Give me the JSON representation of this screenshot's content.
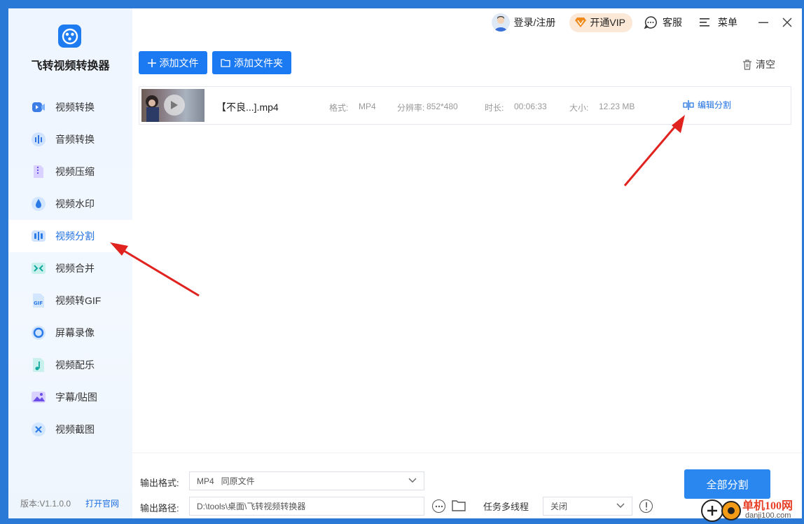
{
  "app": {
    "title": "飞转视频转换器",
    "version": "版本:V1.1.0.0",
    "site_link": "打开官网"
  },
  "topbar": {
    "login": "登录/注册",
    "vip": "开通VIP",
    "service": "客服",
    "menu": "菜单"
  },
  "sidebar": {
    "items": [
      {
        "label": "视频转换",
        "icon": "video-convert-icon"
      },
      {
        "label": "音频转换",
        "icon": "audio-convert-icon"
      },
      {
        "label": "视频压缩",
        "icon": "video-compress-icon"
      },
      {
        "label": "视频水印",
        "icon": "watermark-icon"
      },
      {
        "label": "视频分割",
        "icon": "video-split-icon"
      },
      {
        "label": "视频合并",
        "icon": "video-merge-icon"
      },
      {
        "label": "视频转GIF",
        "icon": "gif-icon"
      },
      {
        "label": "屏幕录像",
        "icon": "screen-record-icon"
      },
      {
        "label": "视频配乐",
        "icon": "music-icon"
      },
      {
        "label": "字幕/贴图",
        "icon": "subtitle-image-icon"
      },
      {
        "label": "视频截图",
        "icon": "screenshot-icon"
      }
    ],
    "active_index": 4
  },
  "toolbar": {
    "add_file": "添加文件",
    "add_folder": "添加文件夹",
    "clear": "清空"
  },
  "files": [
    {
      "name": "【不良...].mp4",
      "format_label": "格式:",
      "format": "MP4",
      "resolution_label": "分辨率:",
      "resolution": "852*480",
      "duration_label": "时长:",
      "duration": "00:06:33",
      "size_label": "大小:",
      "size": "12.23 MB",
      "action": "编辑分割"
    }
  ],
  "output": {
    "format_label": "输出格式:",
    "format_value": "MP4   同原文件",
    "path_label": "输出路径:",
    "path_value": "D:\\tools\\桌面\\飞转视频转换器",
    "multithread_label": "任务多线程",
    "multithread_value": "关闭",
    "split_all": "全部分割"
  },
  "watermark": {
    "text": "单机100网",
    "url": "danji100.com"
  },
  "colors": {
    "accent": "#1b79f2",
    "arrow": "#e0231f",
    "sidebar_bg": "#eef5ff"
  }
}
